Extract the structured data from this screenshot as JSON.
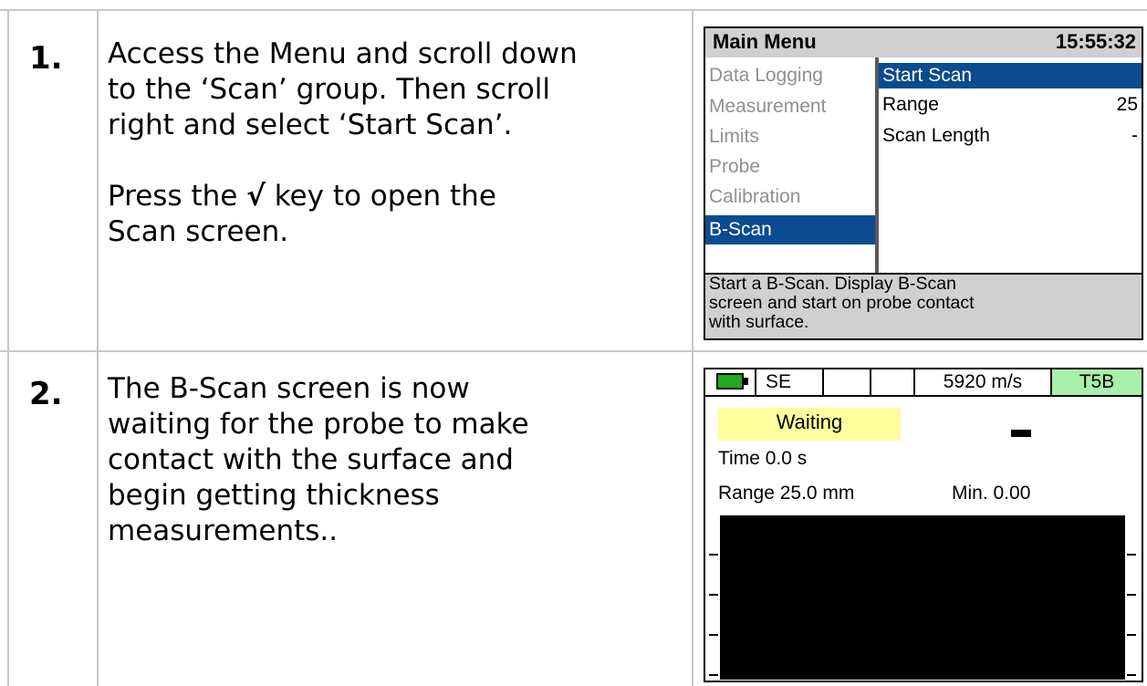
{
  "steps": [
    {
      "number": "1.",
      "text_lines": [
        "Access the Menu and scroll down",
        "to the ‘Scan’ group. Then scroll",
        "right and select ‘Start Scan’."
      ],
      "text2_prefix": "Press the ",
      "text2_key": "√",
      "text2_suffix": " key to open the",
      "text2_line2": "Scan screen."
    },
    {
      "number": "2.",
      "text_lines": [
        "The B-Scan screen is now",
        "waiting for the probe to make",
        "contact with the surface and",
        "begin getting thickness",
        "measurements.."
      ]
    }
  ],
  "main_menu": {
    "title": "Main Menu",
    "clock": "15:55:32",
    "groups": [
      "Data Logging",
      "Measurement",
      "Limits",
      "Probe",
      "Calibration",
      "B-Scan"
    ],
    "selected_group": "B-Scan",
    "items": [
      {
        "label": "Start Scan",
        "value": ""
      },
      {
        "label": "Range",
        "value": "25"
      },
      {
        "label": "Scan Length",
        "value": "-"
      }
    ],
    "description": [
      "Start a B-Scan. Display B-Scan",
      "screen and start on probe contact",
      "with surface."
    ]
  },
  "bscan": {
    "mode": "SE",
    "velocity": "5920 m/s",
    "probe": "T5B",
    "status": "Waiting",
    "reading": "-",
    "time": "Time  0.0 s",
    "range": "Range 25.0 mm",
    "min": "Min. 0.00",
    "colors": {
      "battery": "#1faa1f",
      "probe_bg": "#a8f0a8",
      "status_bg": "#ffff9e",
      "selection": "#0a4b91"
    }
  }
}
